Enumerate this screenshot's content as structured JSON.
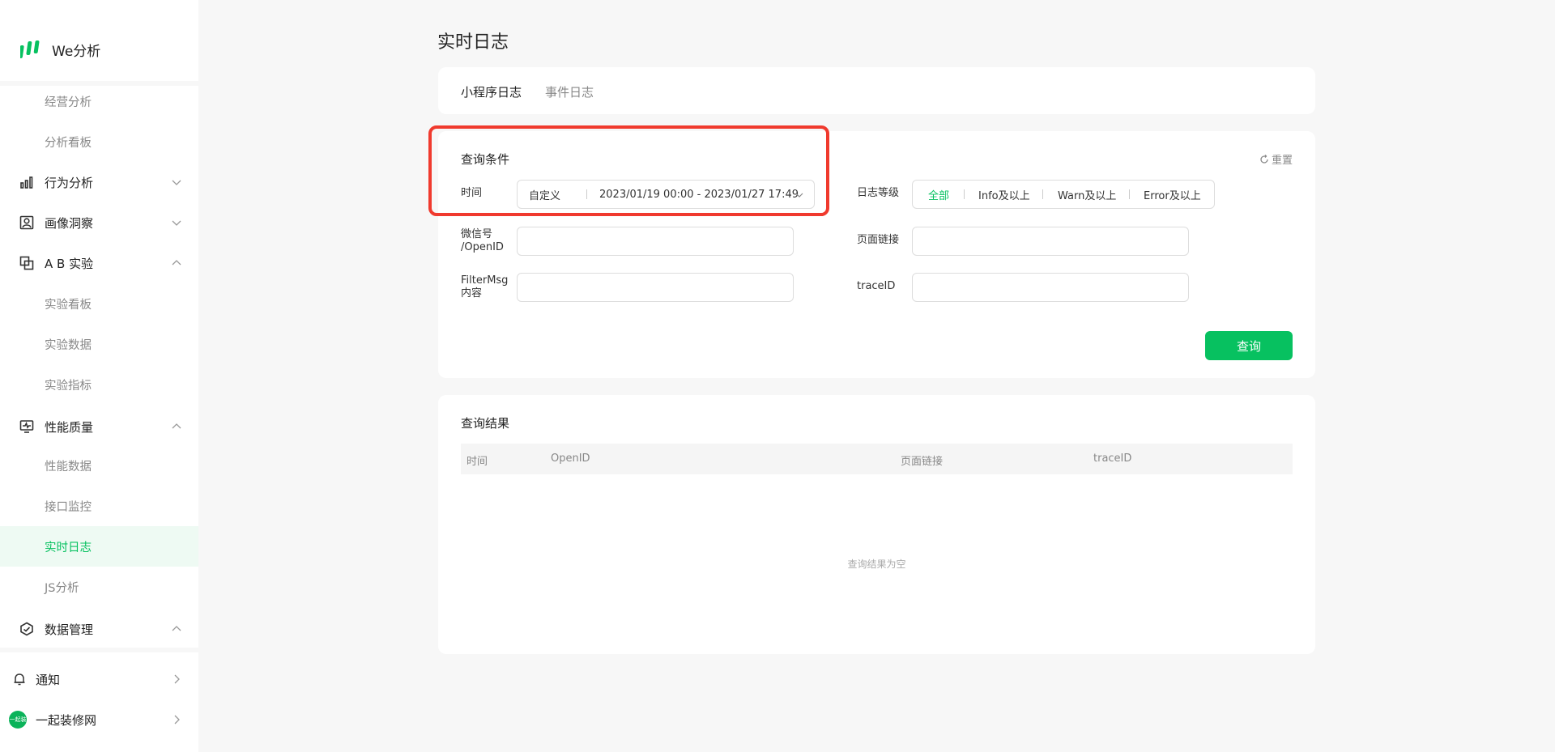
{
  "sidebar": {
    "logo_text": "We分析",
    "items": [
      {
        "label": "经营分析"
      },
      {
        "label": "分析看板"
      },
      {
        "label": "行为分析"
      },
      {
        "label": "画像洞察"
      },
      {
        "label": "A B 实验"
      },
      {
        "label": "实验看板"
      },
      {
        "label": "实验数据"
      },
      {
        "label": "实验指标"
      },
      {
        "label": "性能质量"
      },
      {
        "label": "性能数据"
      },
      {
        "label": "接口监控"
      },
      {
        "label": "实时日志"
      },
      {
        "label": "JS分析"
      },
      {
        "label": "数据管理"
      }
    ],
    "notify_label": "通知",
    "account_label": "一起装修网",
    "account_avatar_text": "一起装修"
  },
  "page": {
    "title": "实时日志"
  },
  "tabs": [
    {
      "label": "小程序日志"
    },
    {
      "label": "事件日志"
    }
  ],
  "conditions": {
    "title": "查询条件",
    "reset_label": "重置",
    "time_label": "时间",
    "time_mode": "自定义",
    "time_range": "2023/01/19 00:00 - 2023/01/27 17:49",
    "level_label": "日志等级",
    "levels": [
      "全部",
      "Info及以上",
      "Warn及以上",
      "Error及以上"
    ],
    "wechat_label": "微信号\n/OpenID",
    "page_link_label": "页面链接",
    "filtermsg_label": "FilterMsg\n内容",
    "traceid_label": "traceID",
    "query_button": "查询"
  },
  "results": {
    "title": "查询结果",
    "columns": [
      "时间",
      "OpenID",
      "页面链接",
      "traceID"
    ],
    "empty_text": "查询结果为空"
  },
  "colors": {
    "accent": "#07c160",
    "highlight": "#f03a2e"
  }
}
